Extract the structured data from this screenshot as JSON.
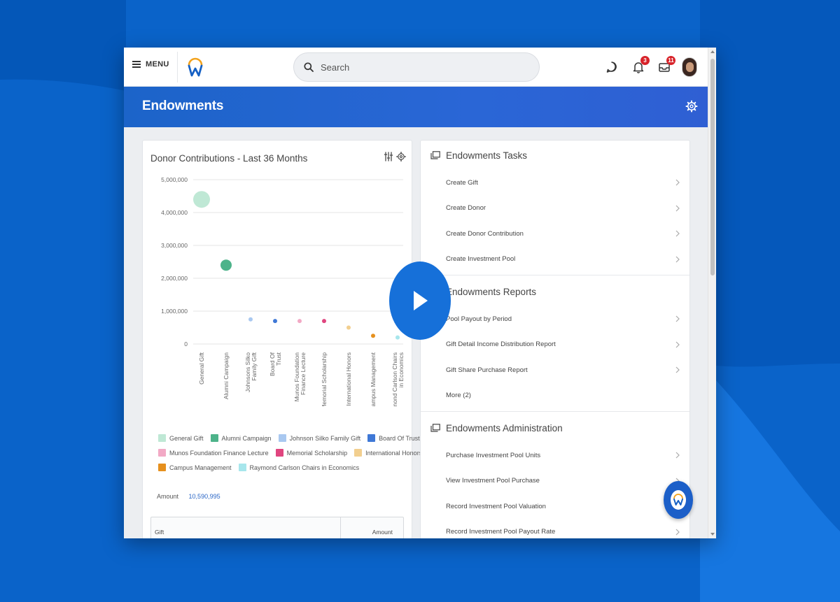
{
  "topbar": {
    "menu_label": "MENU",
    "search_placeholder": "Search",
    "notifications_count": "3",
    "inbox_count": "11"
  },
  "header": {
    "title": "Endowments"
  },
  "chart_panel": {
    "title": "Donor Contributions - Last 36 Months",
    "amount_label": "Amount",
    "amount_value": "10,590,995",
    "table_headers": {
      "gift": "Gift",
      "amount": "Amount"
    }
  },
  "chart_data": {
    "type": "scatter",
    "title": "Donor Contributions - Last 36 Months",
    "categories": [
      "General Gift",
      "Alumni Campaign",
      "Johnson Silko Family Gift",
      "Board Of Trust",
      "Munos Foundation Finance Lecture",
      "Memorial Scholarship",
      "International Honors",
      "Campus Management",
      "Raymond Carlson Chairs in Economics"
    ],
    "tick_categories": [
      "General Gift",
      "Alumni Campaign",
      "Johnsons Silko Family Gift",
      "Board Of Trust",
      "Munos Foundation Finance Lecture",
      "Memorial Scholarship",
      "International Honors",
      "Campus Management",
      "Raymond Carlson Chairs in Economics"
    ],
    "values": [
      4400000,
      2400000,
      750000,
      700000,
      700000,
      700000,
      500000,
      250000,
      200000
    ],
    "bubble_sizes": [
      12,
      8,
      3,
      3,
      3,
      3,
      3,
      3,
      3
    ],
    "colors": [
      "#bfe8d5",
      "#4db38a",
      "#a9c8f0",
      "#3f78d6",
      "#f2a9c5",
      "#e0457f",
      "#f2cf8f",
      "#e6901e",
      "#a7e6ec"
    ],
    "yticks": [
      0,
      1000000,
      2000000,
      3000000,
      4000000,
      5000000
    ],
    "ytick_labels": [
      "0",
      "1,000,000",
      "2,000,000",
      "3,000,000",
      "4,000,000",
      "5,000,000"
    ],
    "ylim": [
      0,
      5000000
    ],
    "grid": true,
    "legend": "bottom"
  },
  "legend_rows": [
    [
      {
        "label": "General Gift",
        "color": "#bfe8d5"
      },
      {
        "label": "Alumni Campaign",
        "color": "#4db38a"
      },
      {
        "label": "Johnson Silko Family Gift",
        "color": "#a9c8f0"
      },
      {
        "label": "Board Of Trust",
        "color": "#3f78d6"
      }
    ],
    [
      {
        "label": "Munos Foundation Finance Lecture",
        "color": "#f2a9c5"
      },
      {
        "label": "Memorial Scholarship",
        "color": "#e0457f"
      },
      {
        "label": "International Honors",
        "color": "#f2cf8f"
      }
    ],
    [
      {
        "label": "Campus Management",
        "color": "#e6901e"
      },
      {
        "label": "Raymond Carlson Chairs in Economics",
        "color": "#a7e6ec"
      }
    ]
  ],
  "tasks": {
    "title": "Endowments Tasks",
    "items": [
      "Create Gift",
      "Create Donor",
      "Create Donor Contribution",
      "Create Investment Pool"
    ]
  },
  "reports": {
    "title": "Endowments Reports",
    "items": [
      "Pool Payout by Period",
      "Gift Detail Income Distribution Report",
      "Gift Share Purchase Report",
      "More (2)"
    ]
  },
  "administration": {
    "title": "Endowments Administration",
    "items": [
      "Purchase Investment Pool Units",
      "View Investment Pool Purchase",
      "Record Investment Pool Valuation",
      "Record Investment Pool Payout Rate"
    ]
  },
  "colors": {
    "background": "#0a63c9",
    "header_blue": "#2a66d6",
    "play_button": "#1670d9",
    "badge_red": "#d8232a"
  }
}
